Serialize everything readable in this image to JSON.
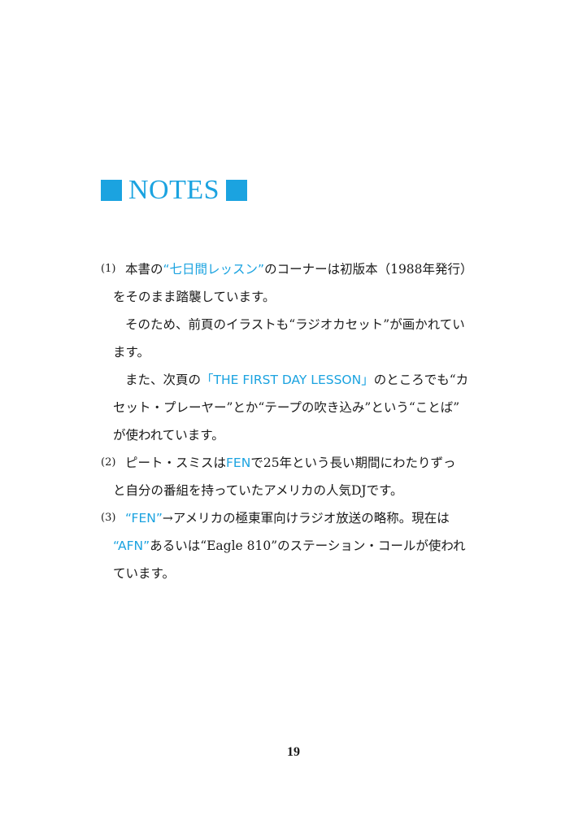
{
  "heading": {
    "title": "NOTES",
    "accent_color": "#1ba3e0"
  },
  "notes": [
    {
      "number": "(1)",
      "lines": [
        {
          "pre": "本書の",
          "hl": "“七日間レッスン”",
          "post": "のコーナーは初版本（1988年発行）"
        },
        {
          "pre": "をそのまま踏襲しています。"
        },
        {
          "pre": "そのため、前頁のイラストも“ラジオカセット”が画かれてい"
        },
        {
          "pre": "ます。"
        },
        {
          "pre": "また、次頁の",
          "hl": "「THE FIRST DAY LESSON」",
          "post": "のところでも“カ"
        },
        {
          "pre": "セット・プレーヤー”とか“テープの吹き込み”という“ことば”"
        },
        {
          "pre": "が使われています。"
        }
      ]
    },
    {
      "number": "(2)",
      "lines": [
        {
          "pre": "ピート・スミスは",
          "hl": "FEN",
          "post": "で25年という長い期間にわたりずっ"
        },
        {
          "pre": "と自分の番組を持っていたアメリカの人気DJです。"
        }
      ]
    },
    {
      "number": "(3)",
      "lines": [
        {
          "pre": "",
          "hl": "“FEN”",
          "post": "→アメリカの極東軍向けラジオ放送の略称。現在は"
        },
        {
          "pre": "",
          "hl": "“AFN”",
          "post": "あるいは“Eagle 810”のステーション・コールが使われ"
        },
        {
          "pre": "ています。"
        }
      ]
    }
  ],
  "page_number": "19"
}
